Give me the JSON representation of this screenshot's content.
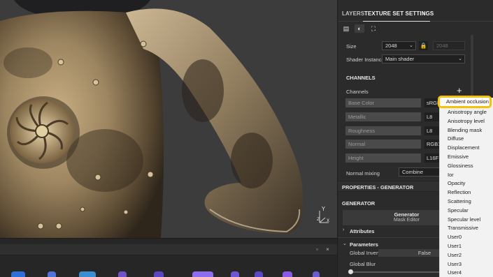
{
  "tabs": {
    "layers": "LAYERS",
    "texture_set_settings": "TEXTURE SET SETTINGS",
    "close": "×"
  },
  "texture_set": {
    "size_label": "Size",
    "size_value": "2048",
    "size_linked_value": "2048",
    "shader_instance_label": "Shader Instance",
    "shader_instance_value": "Main shader",
    "channels_header": "CHANNELS",
    "channels_label": "Channels",
    "add_channel": "+",
    "channels": [
      {
        "name": "Base Color",
        "format": "sRGB"
      },
      {
        "name": "Metallic",
        "format": "L8"
      },
      {
        "name": "Roughness",
        "format": "L8"
      },
      {
        "name": "Normal",
        "format": "RGB1"
      },
      {
        "name": "Height",
        "format": "L16F"
      }
    ],
    "normal_mixing_label": "Normal mixing",
    "normal_mixing_value": "Combine"
  },
  "properties": {
    "header": "PROPERTIES - GENERATOR",
    "generator_header": "GENERATOR",
    "generator_title": "Generator",
    "generator_name": "Mask Editor",
    "attributes": "Attributes",
    "parameters": "Parameters",
    "global_invert_label": "Global Invert",
    "global_invert_value": "False",
    "global_blur_label": "Global Blur"
  },
  "channel_menu": {
    "highlighted": "Ambient occlusion",
    "items": [
      "Anisotropy angle",
      "Anisotropy level",
      "Blending mask",
      "Diffuse",
      "Displacement",
      "Emissive",
      "Glossiness",
      "Ior",
      "Opacity",
      "Reflection",
      "Scattering",
      "Specular",
      "Specular level",
      "Transmissive",
      "User0",
      "User1",
      "User2",
      "User3",
      "User4"
    ]
  },
  "gizmo": {
    "y": "Y",
    "z": "Z",
    "x": "X"
  },
  "colors": {
    "highlight_ring": "#f4c20d",
    "panel_bg": "#2b2b2c",
    "menu_bg": "#f2f2f2"
  }
}
